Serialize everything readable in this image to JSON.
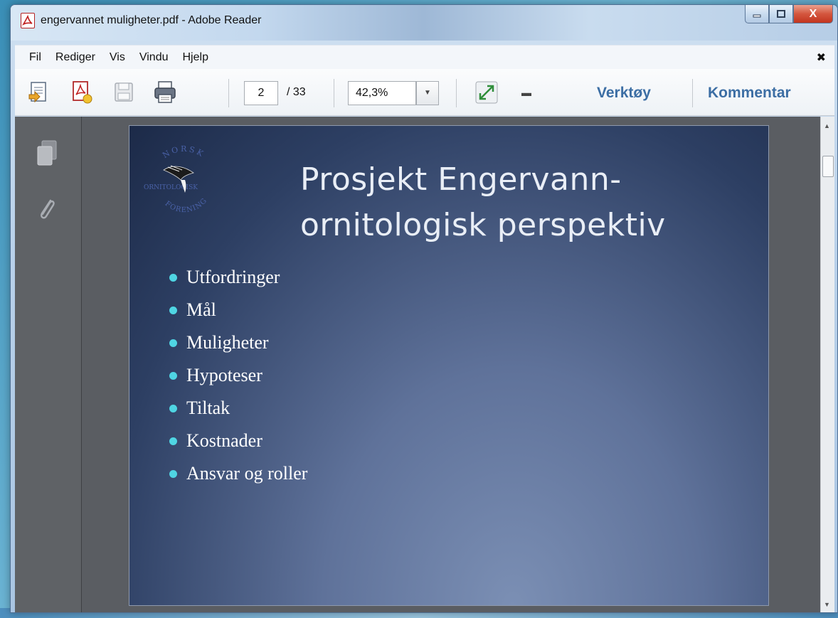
{
  "window": {
    "title": "engervannet muligheter.pdf - Adobe Reader",
    "close_label": "X"
  },
  "menu": {
    "items": [
      "Fil",
      "Rediger",
      "Vis",
      "Vindu",
      "Hjelp"
    ],
    "close_glyph": "✖"
  },
  "toolbar": {
    "current_page": "2",
    "total_pages": "/ 33",
    "zoom": "42,3%",
    "tools_label": "Verktøy",
    "comment_label": "Kommentar"
  },
  "slide": {
    "title_line1": "Prosjekt Engervann-",
    "title_line2": "ornitologisk perspektiv",
    "bullets": [
      "Utfordringer",
      "Mål",
      "Muligheter",
      "Hypoteser",
      "Tiltak",
      "Kostnader",
      "Ansvar og roller"
    ],
    "logo_text_top": "NORSK",
    "logo_text_middle": "ORNITOLOGISK",
    "logo_text_bottom": "FORENING"
  },
  "colors": {
    "accent_link": "#3c6ea4",
    "bullet": "#4fd5e3",
    "slide_dark": "#1c2a48",
    "slide_light": "#7b8fb4"
  }
}
